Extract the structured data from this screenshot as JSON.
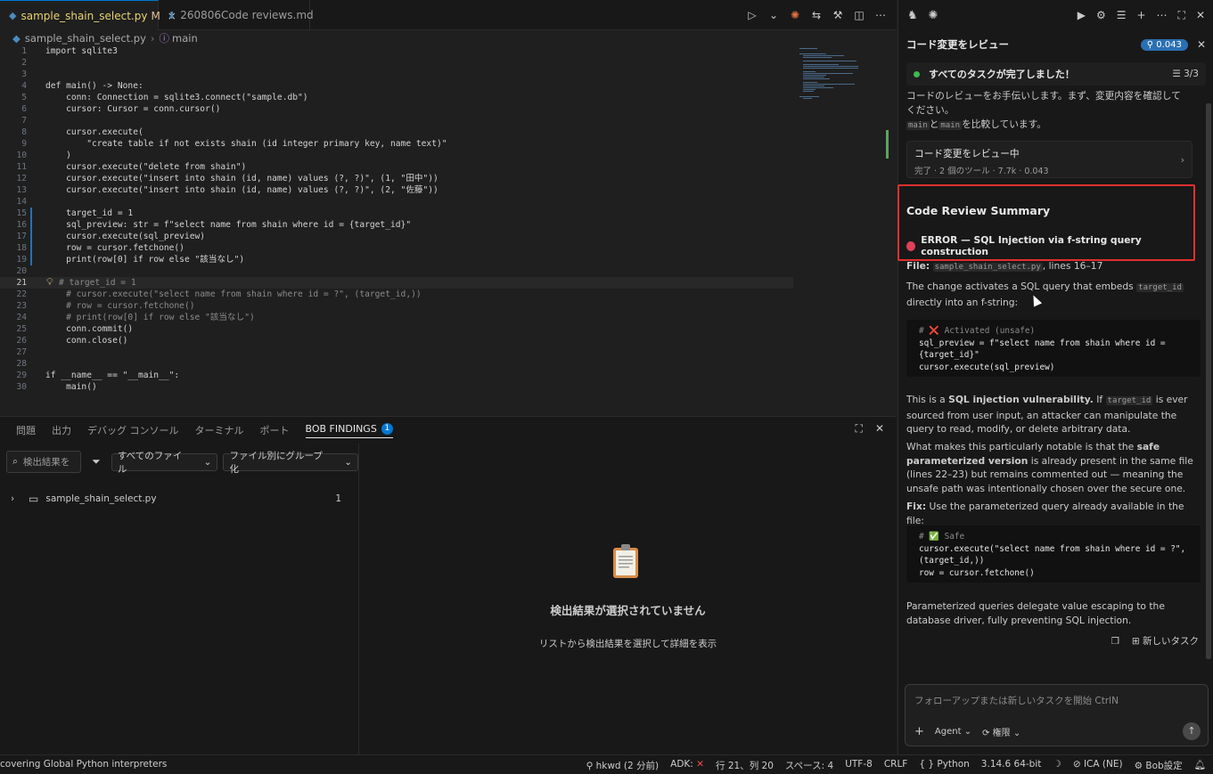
{
  "editor": {
    "tabs": [
      {
        "label": "sample_shain_select.py",
        "modified": "M",
        "close": "×"
      },
      {
        "label": "260806Code reviews.md"
      }
    ],
    "breadcrumb": {
      "file": "sample_shain_select.py",
      "symbol": "main"
    },
    "lines": [
      {
        "n": "1",
        "code": "import sqlite3"
      },
      {
        "n": "2",
        "code": ""
      },
      {
        "n": "3",
        "code": ""
      },
      {
        "n": "4",
        "code": "def main() -> None:"
      },
      {
        "n": "5",
        "code": "    conn: Connection = sqlite3.connect(\"sample.db\")"
      },
      {
        "n": "6",
        "code": "    cursor: Cursor = conn.cursor()"
      },
      {
        "n": "7",
        "code": ""
      },
      {
        "n": "8",
        "code": "    cursor.execute("
      },
      {
        "n": "9",
        "code": "        \"create table if not exists shain (id integer primary key, name text)\""
      },
      {
        "n": "10",
        "code": "    )"
      },
      {
        "n": "11",
        "code": "    cursor.execute(\"delete from shain\")"
      },
      {
        "n": "12",
        "code": "    cursor.execute(\"insert into shain (id, name) values (?, ?)\", (1, \"田中\"))"
      },
      {
        "n": "13",
        "code": "    cursor.execute(\"insert into shain (id, name) values (?, ?)\", (2, \"佐藤\"))"
      },
      {
        "n": "14",
        "code": ""
      },
      {
        "n": "15",
        "code": "    target_id = 1"
      },
      {
        "n": "16",
        "code": "    sql_preview: str = f\"select name from shain where id = {target_id}\""
      },
      {
        "n": "17",
        "code": "    cursor.execute(sql_preview)"
      },
      {
        "n": "18",
        "code": "    row = cursor.fetchone()"
      },
      {
        "n": "19",
        "code": "    print(row[0] if row else \"該当なし\")"
      },
      {
        "n": "20",
        "code": ""
      },
      {
        "n": "21",
        "code": "    # target_id = 1"
      },
      {
        "n": "22",
        "code": "    # cursor.execute(\"select name from shain where id = ?\", (target_id,))"
      },
      {
        "n": "23",
        "code": "    # row = cursor.fetchone()"
      },
      {
        "n": "24",
        "code": "    # print(row[0] if row else \"該当なし\")"
      },
      {
        "n": "25",
        "code": "    conn.commit()"
      },
      {
        "n": "26",
        "code": "    conn.close()"
      },
      {
        "n": "27",
        "code": ""
      },
      {
        "n": "28",
        "code": ""
      },
      {
        "n": "29",
        "code": "if __name__ == \"__main__\":"
      },
      {
        "n": "30",
        "code": "    main()"
      }
    ]
  },
  "panel": {
    "tabs": [
      "問題",
      "出力",
      "デバッグ コンソール",
      "ターミナル",
      "ポート",
      "BOB FINDINGS"
    ],
    "findings_badge": "1",
    "search_placeholder": "検出結果を",
    "filter_files": "すべてのファイル",
    "group_by": "ファイル別にグループ化",
    "tree_file": "sample_shain_select.py",
    "tree_count": "1",
    "empty_title": "検出結果が選択されていません",
    "empty_subtitle": "リストから検出結果を選択して詳細を表示"
  },
  "chat": {
    "title": "コード変更をレビュー",
    "cost": "0.043",
    "task_banner": "すべてのタスクが完了しました！",
    "task_progress": "3/3",
    "intro_line1": "コードのレビューをお手伝いします。まず、変更内容を確認して",
    "intro_line2": "ください。",
    "compare_a": "main",
    "compare_mid": "と",
    "compare_b": "main",
    "compare_suffix": "を比較しています。",
    "tool_card_title": "コード変更をレビュー中",
    "tool_card_meta": "完了 · 2 個のツール · 7.7k · 0.043",
    "summary_heading": "Code Review Summary",
    "error_line": "ERROR — SQL Injection via f-string query construction",
    "file_label": "File:",
    "file_name": "sample_shain_select.py",
    "file_lines": ", lines 16–17",
    "change_text_a": "The change activates a SQL query that embeds",
    "change_code": "target_id",
    "change_text_b": "directly into an f-string:",
    "code1_comment": "# ❌ Activated (unsafe)",
    "code1_l1": "sql_preview = f\"select name from shain where id =",
    "code1_l2": "{target_id}\"",
    "code1_l3": "cursor.execute(sql_preview)",
    "vuln_a": "This is a",
    "vuln_bold": "SQL injection vulnerability.",
    "vuln_b": "If",
    "vuln_code": "target_id",
    "vuln_c": "is ever sourced from user input, an attacker can manipulate the query to read, modify, or delete arbitrary data.",
    "notable_a": "What makes this particularly notable is that the",
    "notable_bold": "safe parameterized version",
    "notable_b": "is already present in the same file (lines 22–23) but remains commented out — meaning the unsafe path was intentionally chosen over the secure one.",
    "fix_label": "Fix:",
    "fix_text": "Use the parameterized query already available in the file:",
    "code2_comment": "# ✅ Safe",
    "code2_l1": "cursor.execute(\"select name from shain where id = ?\",",
    "code2_l2": "(target_id,))",
    "code2_l3": "row = cursor.fetchone()",
    "closing": "Parameterized queries delegate value escaping to the database driver, fully preventing SQL injection.",
    "new_task": "新しいタスク",
    "input_placeholder": "フォローアップまたは新しいタスクを開始 CtrlN",
    "agent_label": "Agent",
    "perm_label": "権限"
  },
  "status": {
    "left": "covering Global Python interpreters",
    "branch": "hkwd (2 分前)",
    "adk": "ADK:",
    "position": "行 21、列 20",
    "spaces": "スペース: 4",
    "encoding": "UTF-8",
    "eol": "CRLF",
    "braces": "{ }",
    "language": "Python",
    "version": "3.14.6 64-bit",
    "ica": "ICA (NE)",
    "bob": "Bob設定"
  }
}
